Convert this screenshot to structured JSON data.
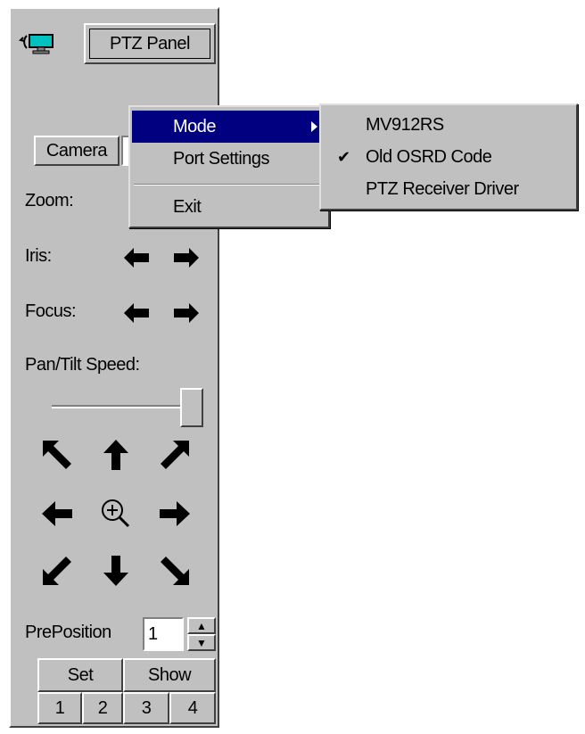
{
  "header": {
    "title_button": "PTZ Panel",
    "app_icon": "camera-network-icon"
  },
  "controls": {
    "camera_button": "Camera",
    "camera_value": "",
    "zoom_label": "Zoom:",
    "iris_label": "Iris:",
    "focus_label": "Focus:",
    "pan_tilt_label": "Pan/Tilt Speed:",
    "pan_tilt_speed_level": 1.0,
    "preposition_label": "PrePosition",
    "preposition_value": "1",
    "set_button": "Set",
    "show_button": "Show",
    "preset_buttons": [
      "1",
      "2",
      "3",
      "4"
    ]
  },
  "icons": {
    "left": "arrow-left-icon",
    "right": "arrow-right-icon",
    "up": "arrow-up-icon",
    "down": "arrow-down-icon",
    "up_left": "arrow-up-left-icon",
    "up_right": "arrow-up-right-icon",
    "down_left": "arrow-down-left-icon",
    "down_right": "arrow-down-right-icon",
    "center": "zoom-in-icon"
  },
  "menu": {
    "items": [
      "Mode",
      "Port Settings",
      "Exit"
    ],
    "highlighted": "Mode"
  },
  "submenu": {
    "items": [
      "MV912RS",
      "Old OSRD Code",
      "PTZ Receiver Driver"
    ],
    "checked": "Old OSRD Code"
  },
  "colors": {
    "face": "#c0c0c0",
    "highlight": "#000080",
    "icon_cyan": "#00c0c0"
  }
}
